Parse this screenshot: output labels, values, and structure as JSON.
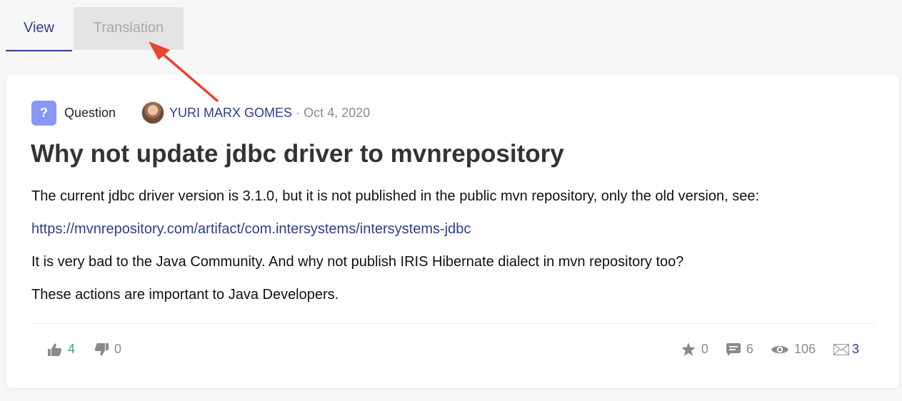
{
  "tabs": {
    "view": "View",
    "translation": "Translation"
  },
  "post": {
    "type_badge": "?",
    "type_label": "Question",
    "author": "YURI MARX GOMES",
    "date": "· Oct 4, 2020",
    "title": "Why not update jdbc driver to mvnrepository",
    "paragraph1": "The current jdbc driver version is 3.1.0, but it is not published in the public mvn repository, only the old version, see:",
    "link": "https://mvnrepository.com/artifact/com.intersystems/intersystems-jdbc",
    "paragraph2": "It is very bad to the Java Community. And why not publish IRIS Hibernate dialect in mvn repository too?",
    "paragraph3": "These actions are important to Java Developers."
  },
  "stats": {
    "likes": "4",
    "dislikes": "0",
    "bookmarks": "0",
    "comments": "6",
    "views": "106",
    "subscribers": "3"
  },
  "colors": {
    "accent": "#2c3e8f",
    "like": "#35a39f",
    "badge": "#8a96f5",
    "annotation_arrow": "#e8452f"
  },
  "icons": [
    "question-icon",
    "thumbs-up-icon",
    "thumbs-down-icon",
    "star-icon",
    "comment-icon",
    "eye-icon",
    "envelope-icon",
    "arrow-annotation"
  ]
}
